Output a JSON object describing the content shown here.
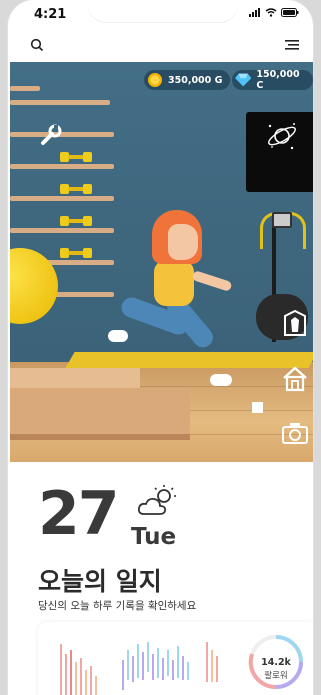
{
  "status_bar": {
    "time": "4:21"
  },
  "currency": {
    "gold": {
      "value": "350,000 G",
      "icon": "gold-coin-icon",
      "color": "#f5b400"
    },
    "diamond": {
      "value": "150,000 C",
      "icon": "diamond-icon",
      "color": "#4fc3f7"
    }
  },
  "diary": {
    "date_number": "27",
    "day_of_week": "Tue",
    "weather_icon": "partly-sunny-icon",
    "title": "오늘의 일지",
    "subtitle": "당신의 오늘 하루 기록을 확인하세요"
  },
  "followers": {
    "count": "14.2k",
    "label": "팔로워"
  },
  "colors": {
    "accent_yellow": "#f0cc1a",
    "wall_blue": "#3f6a82",
    "text_dark": "#3a3a3a"
  }
}
